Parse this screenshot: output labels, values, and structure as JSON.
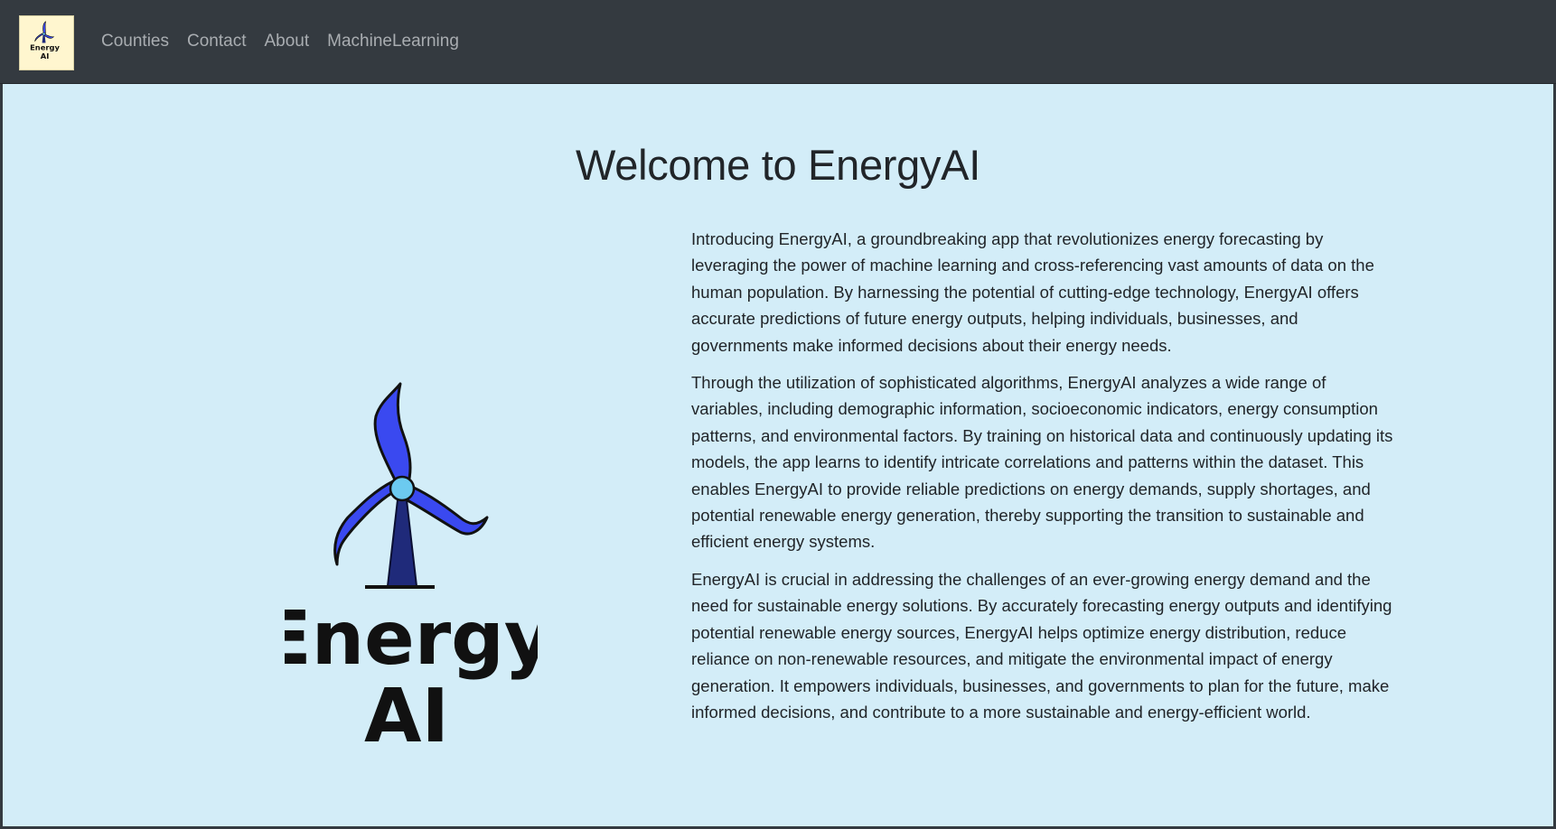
{
  "brand": {
    "logo_name": "energy-ai-logo",
    "logo_text_line1": "Energy",
    "logo_text_line2": "AI"
  },
  "nav": {
    "items": [
      {
        "label": "Counties"
      },
      {
        "label": "Contact"
      },
      {
        "label": "About"
      },
      {
        "label": "MachineLearning"
      }
    ]
  },
  "main": {
    "title": "Welcome to EnergyAI",
    "paragraphs": [
      "Introducing EnergyAI, a groundbreaking app that revolutionizes energy forecasting by leveraging the power of machine learning and cross-referencing vast amounts of data on the human population. By harnessing the potential of cutting-edge technology, EnergyAI offers accurate predictions of future energy outputs, helping individuals, businesses, and governments make informed decisions about their energy needs.",
      "Through the utilization of sophisticated algorithms, EnergyAI analyzes a wide range of variables, including demographic information, socioeconomic indicators, energy consumption patterns, and environmental factors. By training on historical data and continuously updating its models, the app learns to identify intricate correlations and patterns within the dataset. This enables EnergyAI to provide reliable predictions on energy demands, supply shortages, and potential renewable energy generation, thereby supporting the transition to sustainable and efficient energy systems.",
      "EnergyAI is crucial in addressing the challenges of an ever-growing energy demand and the need for sustainable energy solutions. By accurately forecasting energy outputs and identifying potential renewable energy sources, EnergyAI helps optimize energy distribution, reduce reliance on non-renewable resources, and mitigate the environmental impact of energy generation. It empowers individuals, businesses, and governments to plan for the future, make informed decisions, and contribute to a more sustainable and energy-efficient world."
    ]
  },
  "colors": {
    "navbar_bg": "#343a40",
    "nav_link": "#a9adb1",
    "main_bg": "#d3edf8",
    "text": "#212529",
    "blade_blue": "#3a49f0",
    "hub_light_blue": "#6ccaf0",
    "tower_navy": "#1f2a7a",
    "logo_bg": "#fff6cf"
  }
}
